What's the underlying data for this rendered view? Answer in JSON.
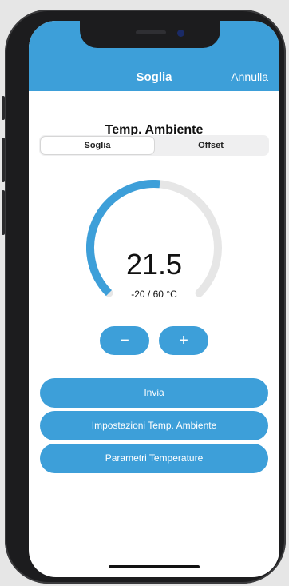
{
  "navbar": {
    "title": "Soglia",
    "cancel_label": "Annulla"
  },
  "page": {
    "title": "Temp. Ambiente"
  },
  "segmented": {
    "options": [
      "Soglia",
      "Offset"
    ],
    "selected": "Soglia"
  },
  "gauge": {
    "value": "21.5",
    "range_text": "-20 / 60 °C",
    "min": -20,
    "max": 60,
    "current": 21.5
  },
  "stepper": {
    "minus_label": "−",
    "plus_label": "+"
  },
  "actions": {
    "send_label": "Invia",
    "settings_label": "Impostazioni Temp. Ambiente",
    "params_label": "Parametri Temperature"
  },
  "colors": {
    "accent": "#3d9fd9",
    "track": "#e6e6e6"
  }
}
